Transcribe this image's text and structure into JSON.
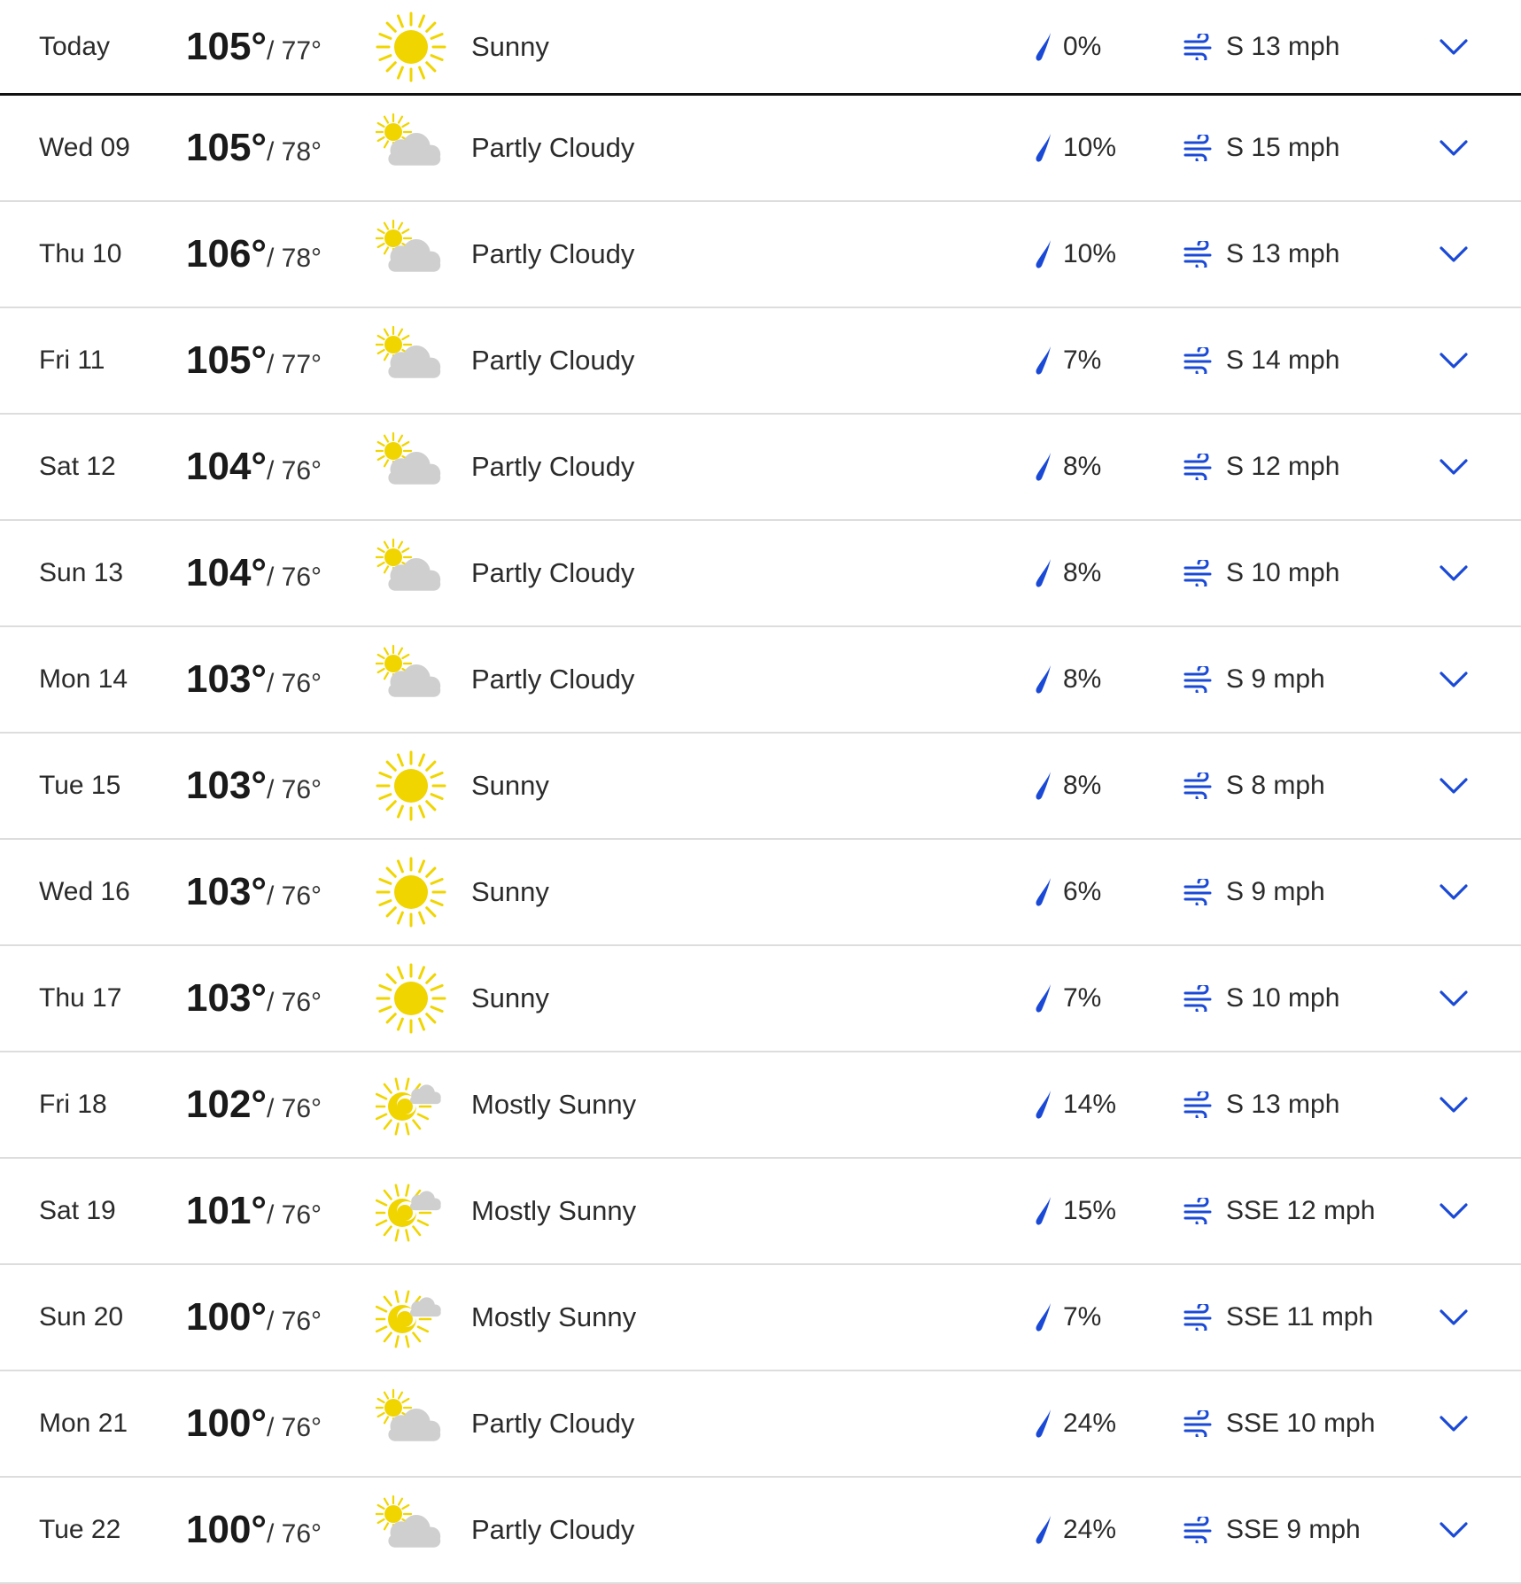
{
  "colors": {
    "accent_blue": "#1a49d6",
    "sun_yellow": "#f0d500",
    "cloud_gray": "#cfcfcf"
  },
  "rows": [
    {
      "day": "Today",
      "hi": "105°",
      "lo": "/ 77°",
      "icon": "sunny-icon",
      "cond": "Sunny",
      "precip": "0%",
      "wind": "S 13 mph"
    },
    {
      "day": "Wed 09",
      "hi": "105°",
      "lo": "/ 78°",
      "icon": "partly-cloudy-icon",
      "cond": "Partly Cloudy",
      "precip": "10%",
      "wind": "S 15 mph"
    },
    {
      "day": "Thu 10",
      "hi": "106°",
      "lo": "/ 78°",
      "icon": "partly-cloudy-icon",
      "cond": "Partly Cloudy",
      "precip": "10%",
      "wind": "S 13 mph"
    },
    {
      "day": "Fri 11",
      "hi": "105°",
      "lo": "/ 77°",
      "icon": "partly-cloudy-icon",
      "cond": "Partly Cloudy",
      "precip": "7%",
      "wind": "S 14 mph"
    },
    {
      "day": "Sat 12",
      "hi": "104°",
      "lo": "/ 76°",
      "icon": "partly-cloudy-icon",
      "cond": "Partly Cloudy",
      "precip": "8%",
      "wind": "S 12 mph"
    },
    {
      "day": "Sun 13",
      "hi": "104°",
      "lo": "/ 76°",
      "icon": "partly-cloudy-icon",
      "cond": "Partly Cloudy",
      "precip": "8%",
      "wind": "S 10 mph"
    },
    {
      "day": "Mon 14",
      "hi": "103°",
      "lo": "/ 76°",
      "icon": "partly-cloudy-icon",
      "cond": "Partly Cloudy",
      "precip": "8%",
      "wind": "S 9 mph"
    },
    {
      "day": "Tue 15",
      "hi": "103°",
      "lo": "/ 76°",
      "icon": "sunny-icon",
      "cond": "Sunny",
      "precip": "8%",
      "wind": "S 8 mph"
    },
    {
      "day": "Wed 16",
      "hi": "103°",
      "lo": "/ 76°",
      "icon": "sunny-icon",
      "cond": "Sunny",
      "precip": "6%",
      "wind": "S 9 mph"
    },
    {
      "day": "Thu 17",
      "hi": "103°",
      "lo": "/ 76°",
      "icon": "sunny-icon",
      "cond": "Sunny",
      "precip": "7%",
      "wind": "S 10 mph"
    },
    {
      "day": "Fri 18",
      "hi": "102°",
      "lo": "/ 76°",
      "icon": "mostly-sunny-icon",
      "cond": "Mostly Sunny",
      "precip": "14%",
      "wind": "S 13 mph"
    },
    {
      "day": "Sat 19",
      "hi": "101°",
      "lo": "/ 76°",
      "icon": "mostly-sunny-icon",
      "cond": "Mostly Sunny",
      "precip": "15%",
      "wind": "SSE 12 mph"
    },
    {
      "day": "Sun 20",
      "hi": "100°",
      "lo": "/ 76°",
      "icon": "mostly-sunny-icon",
      "cond": "Mostly Sunny",
      "precip": "7%",
      "wind": "SSE 11 mph"
    },
    {
      "day": "Mon 21",
      "hi": "100°",
      "lo": "/ 76°",
      "icon": "partly-cloudy-icon",
      "cond": "Partly Cloudy",
      "precip": "24%",
      "wind": "SSE 10 mph"
    },
    {
      "day": "Tue 22",
      "hi": "100°",
      "lo": "/ 76°",
      "icon": "partly-cloudy-icon",
      "cond": "Partly Cloudy",
      "precip": "24%",
      "wind": "SSE 9 mph"
    }
  ]
}
